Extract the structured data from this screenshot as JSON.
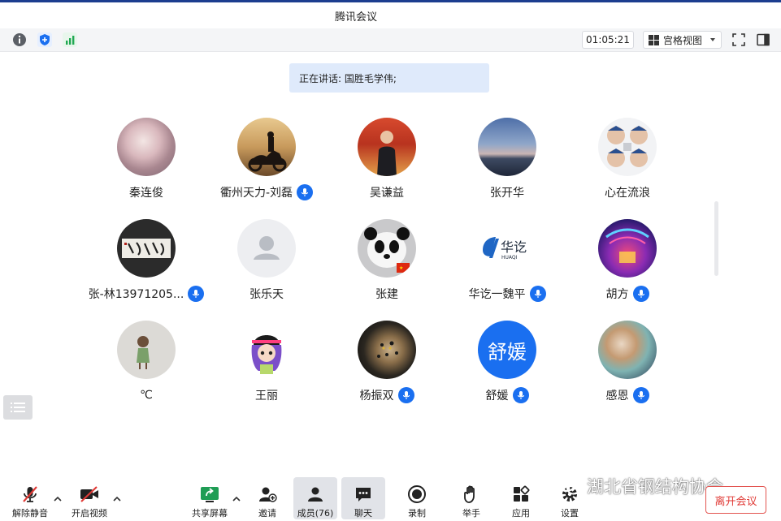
{
  "window": {
    "title": "腾讯会议"
  },
  "toolbar": {
    "timer": "01:05:21",
    "view_label": "宫格视图",
    "info_icon": "info-icon",
    "security_icon": "shield-icon",
    "network_icon": "signal-bars-icon",
    "fullscreen_icon": "fullscreen-icon",
    "sidebar_icon": "sidebar-toggle-icon"
  },
  "speaking": {
    "text": "正在讲话: 国胜毛学伟;"
  },
  "participants": [
    {
      "name": "秦连俊",
      "mic": false
    },
    {
      "name": "衢州天力-刘磊",
      "mic": true
    },
    {
      "name": "吴谦益",
      "mic": false
    },
    {
      "name": "张开华",
      "mic": false
    },
    {
      "name": "心在流浪",
      "mic": false
    },
    {
      "name": "张-林13971205...",
      "mic": true
    },
    {
      "name": "张乐天",
      "mic": false
    },
    {
      "name": "张建",
      "mic": false
    },
    {
      "name": "华讫一魏平",
      "mic": true
    },
    {
      "name": "胡方",
      "mic": true
    },
    {
      "name": "℃",
      "mic": false
    },
    {
      "name": "王丽",
      "mic": false
    },
    {
      "name": "杨振双",
      "mic": true
    },
    {
      "name": "舒媛",
      "mic": true,
      "avatar_text": "舒媛"
    },
    {
      "name": "感恩",
      "mic": true
    }
  ],
  "avatar_texts": {
    "logo_cn": "华讫",
    "logo_en": "HUAQI"
  },
  "bottom": {
    "unmute": "解除静音",
    "video": "开启视频",
    "share": "共享屏幕",
    "invite": "邀请",
    "members": "成员(76)",
    "chat": "聊天",
    "record": "录制",
    "raise_hand": "举手",
    "apps": "应用",
    "settings": "设置",
    "leave": "离开会议"
  },
  "watermark": {
    "text": "湖北省钢结构协会"
  },
  "colors": {
    "accent": "#1a6ff0",
    "leave": "#e03a36",
    "speaking_bg": "#dfeafb",
    "share_green": "#1f9d55"
  }
}
